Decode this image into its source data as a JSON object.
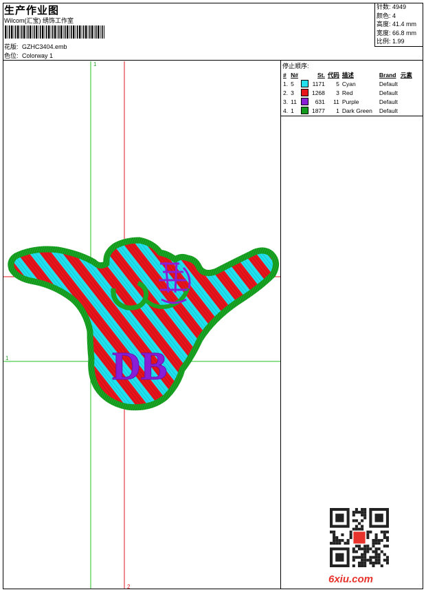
{
  "header": {
    "title": "生产作业图",
    "company": "Wilcom(汇宝) 绣饰工作室",
    "design_label": "花版:",
    "design_value": "GZHC3404.emb",
    "colorway_label": "色位:",
    "colorway_value": "Colorway 1"
  },
  "stats": [
    {
      "label": "针数:",
      "value": "4949"
    },
    {
      "label": "颜色:",
      "value": "4"
    },
    {
      "label": "高度:",
      "value": "41.4 mm"
    },
    {
      "label": "宽度:",
      "value": "66.8 mm"
    },
    {
      "label": "比例:",
      "value": "1.99"
    }
  ],
  "stop_sequence": {
    "title": "停止顺序:",
    "headers": [
      "#",
      "N#",
      "St.",
      "代码",
      "描述",
      "Brand",
      "元素"
    ],
    "rows": [
      {
        "num": "1.",
        "n": "5",
        "color": "#22e0ee",
        "st": "1171",
        "code": "5",
        "desc": "Cyan",
        "brand": "Default"
      },
      {
        "num": "2.",
        "n": "3",
        "color": "#e8141c",
        "st": "1268",
        "code": "3",
        "desc": "Red",
        "brand": "Default"
      },
      {
        "num": "3.",
        "n": "11",
        "color": "#8a1ed6",
        "st": "631",
        "code": "11",
        "desc": "Purple",
        "brand": "Default"
      },
      {
        "num": "4.",
        "n": "1",
        "color": "#139a1c",
        "st": "1877",
        "code": "1",
        "desc": "Dark Green",
        "brand": "Default"
      }
    ]
  },
  "canvas": {
    "guide_labels": {
      "top": "1",
      "left": "1",
      "right": "2",
      "bottom": "2"
    },
    "embroidery_text": "DB"
  },
  "watermark": {
    "site": "6xiu.com"
  }
}
